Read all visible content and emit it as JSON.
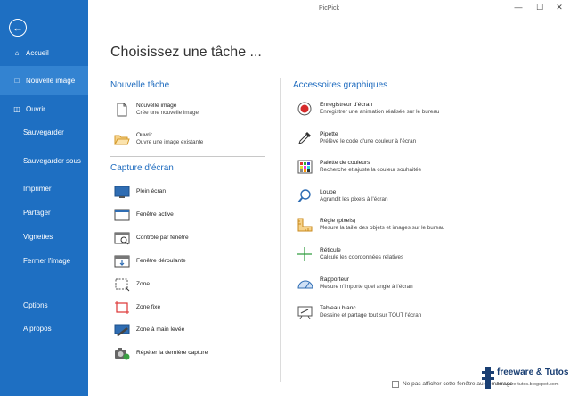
{
  "window": {
    "title": "PicPick",
    "min": "—",
    "max": "☐",
    "close": "✕"
  },
  "sidebar": {
    "back_icon": "arrow-left-icon",
    "items": [
      {
        "label": "Accueil",
        "icon": "home-icon"
      },
      {
        "label": "Nouvelle image",
        "icon": "new-image-icon"
      },
      {
        "label": "Ouvrir",
        "icon": "folder-icon"
      },
      {
        "label": "Sauvegarder"
      },
      {
        "label": "Sauvegarder sous"
      },
      {
        "label": "Imprimer"
      },
      {
        "label": "Partager"
      },
      {
        "label": "Vignettes"
      },
      {
        "label": "Fermer l'image"
      },
      {
        "label": "Options"
      },
      {
        "label": "A propos"
      }
    ]
  },
  "main": {
    "title": "Choisissez une tâche ...",
    "new_task": {
      "heading": "Nouvelle tâche",
      "items": [
        {
          "title": "Nouvelle image",
          "desc": "Crée une nouvelle image",
          "icon": "blank-page-icon"
        },
        {
          "title": "Ouvrir",
          "desc": "Ouvre une image existante",
          "icon": "open-folder-icon"
        }
      ]
    },
    "capture": {
      "heading": "Capture d'écran",
      "items": [
        {
          "label": "Plein écran",
          "icon": "full-screen-icon"
        },
        {
          "label": "Fenêtre active",
          "icon": "active-window-icon"
        },
        {
          "label": "Contrôle par fenêtre",
          "icon": "window-control-icon"
        },
        {
          "label": "Fenêtre déroulante",
          "icon": "scrolling-window-icon"
        },
        {
          "label": "Zone",
          "icon": "region-icon"
        },
        {
          "label": "Zone fixe",
          "icon": "fixed-region-icon"
        },
        {
          "label": "Zone à main levée",
          "icon": "freehand-icon"
        },
        {
          "label": "Répéter la dernière capture",
          "icon": "repeat-capture-icon"
        }
      ]
    },
    "accessories": {
      "heading": "Accessoires graphiques",
      "items": [
        {
          "title": "Enregistreur d'écran",
          "desc": "Enregistrer une animation réalisée sur le bureau",
          "icon": "record-icon"
        },
        {
          "title": "Pipette",
          "desc": "Prélève le code d'une couleur à l'écran",
          "icon": "eyedropper-icon"
        },
        {
          "title": "Palette de couleurs",
          "desc": "Recherche et ajuste la couleur souhaitée",
          "icon": "color-palette-icon"
        },
        {
          "title": "Loupe",
          "desc": "Agrandit les pixels à l'écran",
          "icon": "magnifier-icon"
        },
        {
          "title": "Règle (pixels)",
          "desc": "Mesure la taille des objets et images sur le bureau",
          "icon": "ruler-icon"
        },
        {
          "title": "Réticule",
          "desc": "Calcule les coordonnées relatives",
          "icon": "crosshair-icon"
        },
        {
          "title": "Rapporteur",
          "desc": "Mesure n'importe quel angle à l'écran",
          "icon": "protractor-icon"
        },
        {
          "title": "Tableau blanc",
          "desc": "Dessine et partage tout sur TOUT l'écran",
          "icon": "whiteboard-icon"
        }
      ]
    }
  },
  "footer": {
    "dont_show_label": "Ne pas afficher cette fenêtre au démarrage"
  },
  "watermark": {
    "title": "freeware & Tutos",
    "subtitle": "freeware-tutos.blogspot.com"
  },
  "colors": {
    "sidebar": "#1e6fc2",
    "sidebar_active": "#3383d1",
    "accent": "#1f6cbf"
  }
}
